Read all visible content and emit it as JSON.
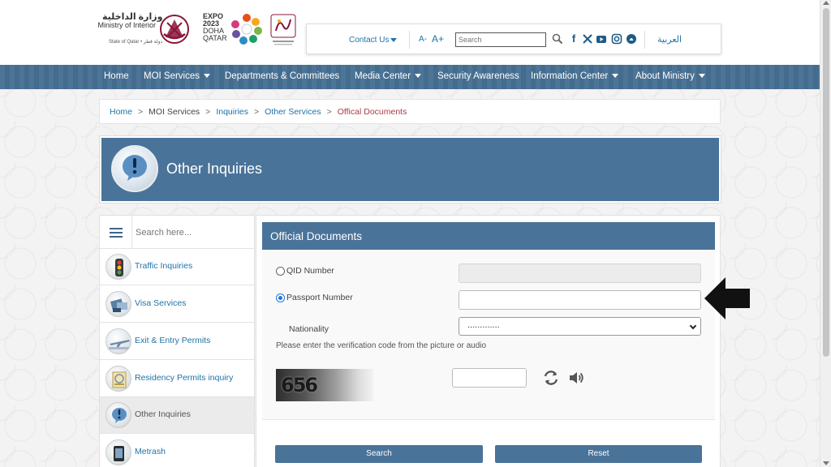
{
  "header": {
    "moi_ar": "وزارة الداخلية",
    "moi_en": "Ministry of Interior",
    "moi_sub": "State of Qatar • دولة قطر",
    "expo": [
      "EXPO",
      "2023",
      "DOHA",
      "QATAR"
    ]
  },
  "topbar": {
    "contact_label": "Contact Us",
    "font_minus": "A-",
    "font_plus": "A+",
    "search_placeholder": "Search",
    "arabic_label": "العربية"
  },
  "nav": {
    "items": [
      {
        "label": "Home",
        "dropdown": false
      },
      {
        "label": "MOI Services",
        "dropdown": true
      },
      {
        "label": "Departments & Committees",
        "dropdown": false
      },
      {
        "label": "Media Center",
        "dropdown": true
      },
      {
        "label": "Security Awareness",
        "dropdown": false
      },
      {
        "label": "Information Center",
        "dropdown": true
      },
      {
        "label": "About Ministry",
        "dropdown": true
      }
    ]
  },
  "breadcrumb": {
    "home": "Home",
    "moi_services": "MOI Services",
    "inquiries": "Inquiries",
    "other_services": "Other Services",
    "current": "Offical Documents"
  },
  "banner": {
    "title": "Other Inquiries"
  },
  "sidebar": {
    "search_placeholder": "Search here...",
    "items": [
      {
        "label": "Traffic Inquiries",
        "icon": "traffic-light-icon"
      },
      {
        "label": "Visa Services",
        "icon": "visa-icon"
      },
      {
        "label": "Exit & Entry Permits",
        "icon": "airplane-icon"
      },
      {
        "label": "Residency Permits inquiry",
        "icon": "residency-icon"
      },
      {
        "label": "Other Inquiries",
        "icon": "exclamation-icon",
        "active": true
      },
      {
        "label": "Metrash",
        "icon": "metrash-icon"
      }
    ]
  },
  "form": {
    "title": "Official Documents",
    "qid_label": "QID Number",
    "passport_label": "Passport Number",
    "selected_option": "passport",
    "nationality_label": "Nationality",
    "nationality_value": ".............",
    "verification_text": "Please enter the verification code from the picture or audio",
    "captcha_code": "656",
    "search_button": "Search",
    "reset_button": "Reset"
  },
  "colors": {
    "primary": "#4a7399",
    "link": "#1e73a8",
    "breadcrumb_current": "#a93a4a"
  }
}
